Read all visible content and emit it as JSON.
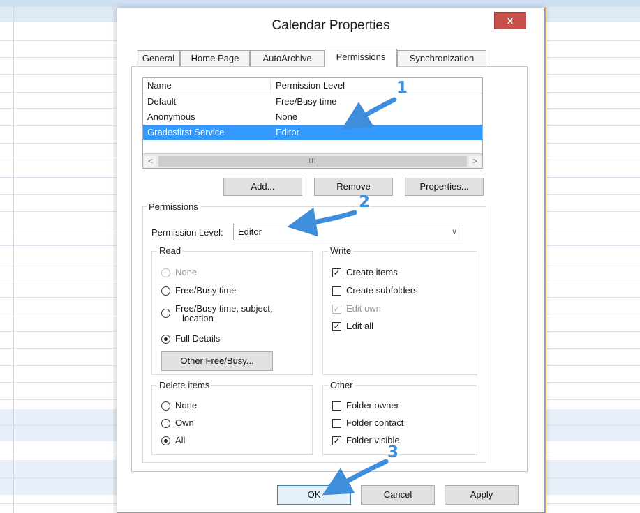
{
  "dialog": {
    "title": "Calendar Properties",
    "close_glyph": "x"
  },
  "tabs": [
    {
      "label": "General",
      "active": false
    },
    {
      "label": "Home Page",
      "active": false
    },
    {
      "label": "AutoArchive",
      "active": false
    },
    {
      "label": "Permissions",
      "active": true
    },
    {
      "label": "Synchronization",
      "active": false
    }
  ],
  "permission_list": {
    "columns": [
      "Name",
      "Permission Level"
    ],
    "rows": [
      {
        "name": "Default",
        "level": "Free/Busy time",
        "selected": false
      },
      {
        "name": "Anonymous",
        "level": "None",
        "selected": false
      },
      {
        "name": "Gradesfirst Service",
        "level": "Editor",
        "selected": true
      }
    ],
    "scroll_left": "<",
    "scroll_grip": "III",
    "scroll_right": ">"
  },
  "list_buttons": {
    "add": "Add...",
    "remove": "Remove",
    "properties": "Properties..."
  },
  "permissions": {
    "group_label": "Permissions",
    "level_label": "Permission Level:",
    "level_value": "Editor",
    "read": {
      "label": "Read",
      "options": [
        {
          "label": "None",
          "checked": false,
          "disabled": true
        },
        {
          "label": "Free/Busy time",
          "checked": false,
          "disabled": false
        },
        {
          "label": "Free/Busy time, subject,",
          "label2": "location",
          "checked": false,
          "disabled": false
        },
        {
          "label": "Full Details",
          "checked": true,
          "disabled": false
        }
      ],
      "other_button": "Other Free/Busy..."
    },
    "write": {
      "label": "Write",
      "options": [
        {
          "label": "Create items",
          "checked": true,
          "disabled": false
        },
        {
          "label": "Create subfolders",
          "checked": false,
          "disabled": false
        },
        {
          "label": "Edit own",
          "checked": true,
          "disabled": true
        },
        {
          "label": "Edit all",
          "checked": true,
          "disabled": false
        }
      ]
    },
    "delete": {
      "label": "Delete items",
      "options": [
        {
          "label": "None",
          "checked": false
        },
        {
          "label": "Own",
          "checked": false
        },
        {
          "label": "All",
          "checked": true
        }
      ]
    },
    "other": {
      "label": "Other",
      "options": [
        {
          "label": "Folder owner",
          "checked": false
        },
        {
          "label": "Folder contact",
          "checked": false
        },
        {
          "label": "Folder visible",
          "checked": true
        }
      ]
    }
  },
  "footer": {
    "ok": "OK",
    "cancel": "Cancel",
    "apply": "Apply"
  },
  "annotations": {
    "step1": "1",
    "step2": "2",
    "step3": "3",
    "color": "#3f8edc"
  },
  "colors": {
    "selection": "#3399ff",
    "close_button": "#c7504b"
  }
}
